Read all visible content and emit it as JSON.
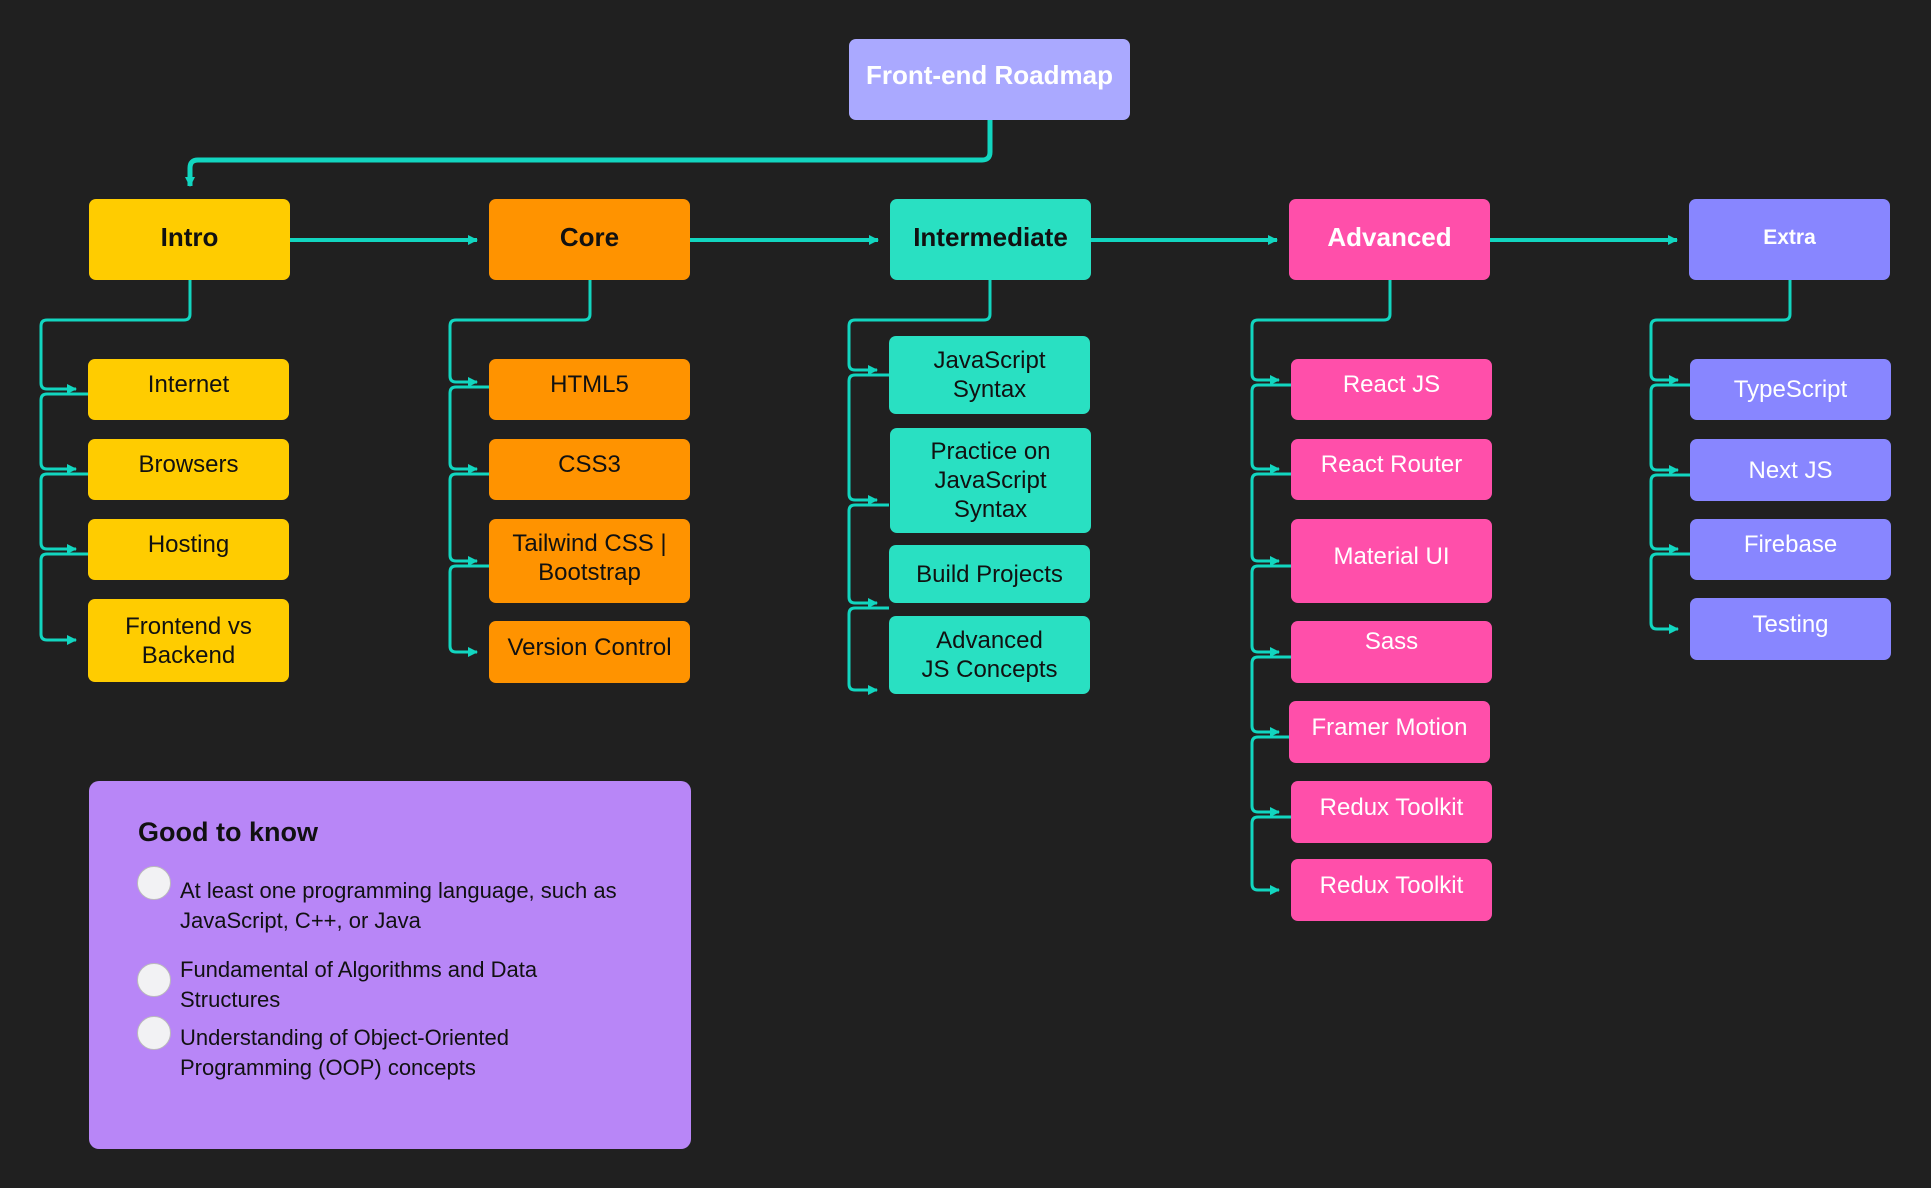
{
  "title": "Front-end Roadmap",
  "colors": {
    "connector": "#12D6C0",
    "background": "#202020"
  },
  "stages": [
    {
      "label": "Intro",
      "color": "#FFCC00",
      "items": [
        "Internet",
        "Browsers",
        "Hosting",
        "Frontend vs Backend"
      ]
    },
    {
      "label": "Core",
      "color": "#FF9300",
      "items": [
        "HTML5",
        "CSS3",
        "Tailwind CSS | Bootstrap",
        "Version Control"
      ]
    },
    {
      "label": "Intermediate",
      "color": "#29E0C2",
      "items": [
        "JavaScript Syntax",
        "Practice on JavaScript Syntax",
        "Build Projects",
        "Advanced JS Concepts"
      ]
    },
    {
      "label": "Advanced",
      "color": "#FF4FAA",
      "items": [
        "React JS",
        "React Router",
        "Material UI",
        "Sass",
        "Framer Motion",
        "Redux Toolkit",
        "Redux Toolkit"
      ]
    },
    {
      "label": "Extra",
      "color": "#8886FF",
      "items": [
        "TypeScript",
        "Next JS",
        "Firebase",
        "Testing"
      ]
    }
  ],
  "good_to_know": {
    "heading": "Good to know",
    "items": [
      "At least one programming language, such as JavaScript, C++, or Java",
      "Fundamental of Algorithms and Data Structures",
      "Understanding of Object-Oriented Programming (OOP) concepts"
    ]
  }
}
